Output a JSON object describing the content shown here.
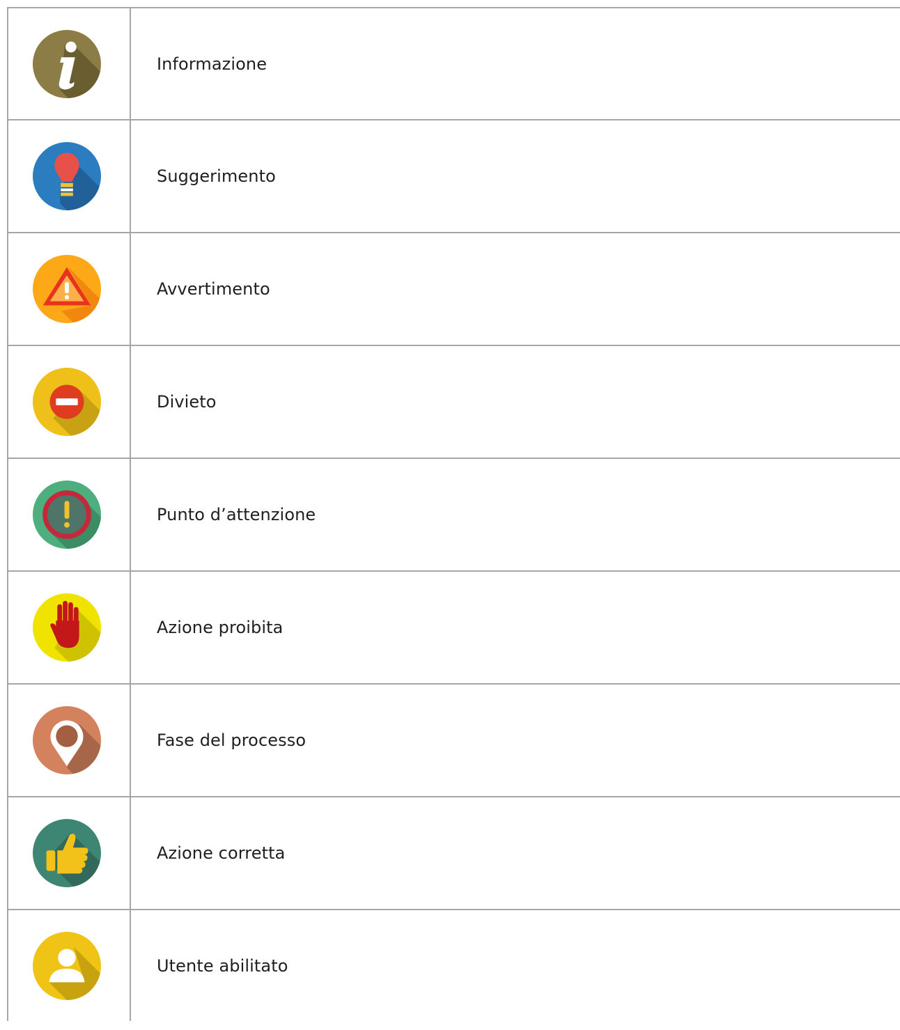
{
  "rows": [
    {
      "icon": "info-icon",
      "label": "Informazione"
    },
    {
      "icon": "lightbulb-icon",
      "label": "Suggerimento"
    },
    {
      "icon": "warning-triangle-icon",
      "label": "Avvertimento"
    },
    {
      "icon": "no-entry-icon",
      "label": "Divieto"
    },
    {
      "icon": "exclamation-circle-icon",
      "label": "Punto d’attenzione"
    },
    {
      "icon": "stop-hand-icon",
      "label": "Azione proibita"
    },
    {
      "icon": "map-pin-icon",
      "label": "Fase del processo"
    },
    {
      "icon": "thumbs-up-icon",
      "label": "Azione corretta"
    },
    {
      "icon": "user-icon",
      "label": "Utente abilitato"
    }
  ],
  "colors": {
    "border": "#a6a6a6",
    "info": "#8b7d45",
    "suggestion": "#2b7dc0",
    "warning": "#fda817",
    "prohibition": "#efbf1a",
    "attention": "#4fae7e",
    "forbidden_action": "#f1e300",
    "process_step": "#d4825e",
    "correct_action": "#3e8674",
    "authorized_user": "#f0c416"
  }
}
